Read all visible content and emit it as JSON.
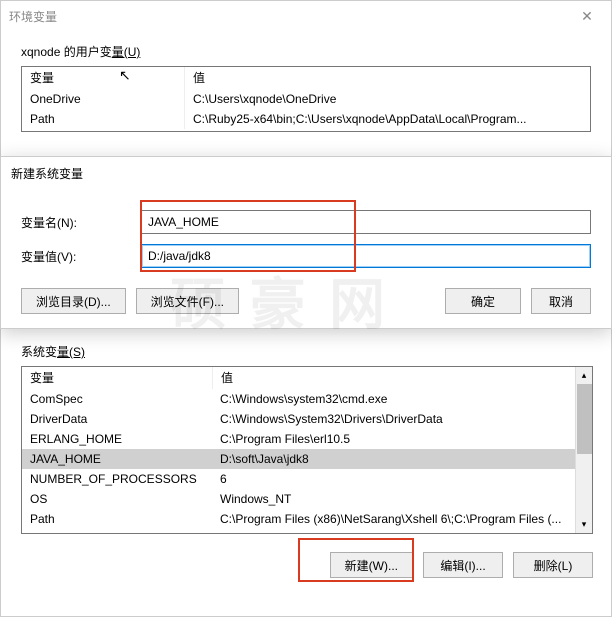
{
  "main_dialog": {
    "title": "环境变量",
    "close": "✕"
  },
  "user_vars_section": {
    "label_prefix": "xqnode 的用户变",
    "label_underline_part": "量(U)",
    "header_name": "变量",
    "header_value": "值",
    "rows": [
      {
        "name": "OneDrive",
        "value": "C:\\Users\\xqnode\\OneDrive"
      },
      {
        "name": "Path",
        "value": "C:\\Ruby25-x64\\bin;C:\\Users\\xqnode\\AppData\\Local\\Program..."
      }
    ]
  },
  "new_var_dialog": {
    "title": "新建系统变量",
    "name_label": "变量名(N):",
    "value_label": "变量值(V):",
    "name_input": "JAVA_HOME",
    "value_input": "D:/java/jdk8",
    "browse_dir": "浏览目录(D)...",
    "browse_file": "浏览文件(F)...",
    "ok": "确定",
    "cancel": "取消"
  },
  "sys_vars_section": {
    "label_prefix": "系统变",
    "label_underline_part": "量(S)",
    "header_name": "变量",
    "header_value": "值",
    "rows": [
      {
        "name": "ComSpec",
        "value": "C:\\Windows\\system32\\cmd.exe"
      },
      {
        "name": "DriverData",
        "value": "C:\\Windows\\System32\\Drivers\\DriverData"
      },
      {
        "name": "ERLANG_HOME",
        "value": "C:\\Program Files\\erl10.5"
      },
      {
        "name": "JAVA_HOME",
        "value": "D:\\soft\\Java\\jdk8",
        "selected": true
      },
      {
        "name": "NUMBER_OF_PROCESSORS",
        "value": "6"
      },
      {
        "name": "OS",
        "value": "Windows_NT"
      },
      {
        "name": "Path",
        "value": "C:\\Program Files (x86)\\NetSarang\\Xshell 6\\;C:\\Program Files (..."
      }
    ],
    "new_btn": "新建(W)...",
    "edit_btn": "编辑(I)...",
    "delete_btn": "删除(L)"
  },
  "watermark": "硕 豪 网"
}
